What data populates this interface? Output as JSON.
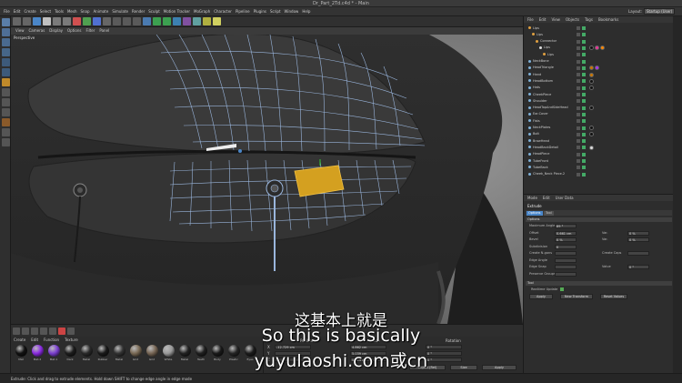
{
  "window": {
    "title": "Dr_Part_2Td.c4d * - Main"
  },
  "menubar": {
    "items": [
      "File",
      "Edit",
      "Create",
      "Select",
      "Tools",
      "Mesh",
      "Snap",
      "Animate",
      "Simulate",
      "Render",
      "Sculpt",
      "Motion Tracker",
      "MoGraph",
      "Character",
      "Pipeline",
      "Plugins",
      "Script",
      "Window",
      "Help"
    ],
    "layout_label": "Layout:",
    "layout_value": "Startup (User)"
  },
  "viewport": {
    "menu": [
      "View",
      "Cameras",
      "Display",
      "Options",
      "Filter",
      "Panel"
    ],
    "label": "Perspective"
  },
  "object_manager": {
    "menu": [
      "File",
      "Edit",
      "View",
      "Objects",
      "Tags",
      "Bookmarks"
    ],
    "rows": [
      {
        "name": "Lips",
        "indent": 0,
        "color": "#e0a040",
        "tags": []
      },
      {
        "name": "Lips",
        "indent": 1,
        "color": "#e0a040",
        "tags": []
      },
      {
        "name": "Connector",
        "indent": 2,
        "color": "#e0a040",
        "tags": []
      },
      {
        "name": "Lips",
        "indent": 3,
        "color": "#dddddd",
        "tags": [
          "#111",
          "#e39",
          "#f80"
        ]
      },
      {
        "name": "Lips",
        "indent": 4,
        "color": "#e0a040",
        "tags": []
      },
      {
        "name": "NeckBone",
        "indent": 0,
        "color": "#7fb0d8",
        "tags": []
      },
      {
        "name": "HeadTriangle",
        "indent": 0,
        "color": "#7fb0d8",
        "tags": [
          "#c70",
          "#a3e"
        ]
      },
      {
        "name": "Hand",
        "indent": 0,
        "color": "#7fb0d8",
        "tags": [
          "#c70"
        ]
      },
      {
        "name": "HeadBottom",
        "indent": 0,
        "color": "#7fb0d8",
        "tags": [
          "#111"
        ]
      },
      {
        "name": "Hats",
        "indent": 0,
        "color": "#7fb0d8",
        "tags": [
          "#111"
        ]
      },
      {
        "name": "CheekPiece",
        "indent": 0,
        "color": "#7fb0d8",
        "tags": []
      },
      {
        "name": "Shoulder",
        "indent": 0,
        "color": "#7fb0d8",
        "tags": []
      },
      {
        "name": "HeadTopAndSideHead",
        "indent": 0,
        "color": "#7fb0d8",
        "tags": [
          "#111"
        ]
      },
      {
        "name": "Ear.Cover",
        "indent": 0,
        "color": "#7fb0d8",
        "tags": []
      },
      {
        "name": "Fists",
        "indent": 0,
        "color": "#7fb0d8",
        "tags": []
      },
      {
        "name": "NeckPlates",
        "indent": 0,
        "color": "#7fb0d8",
        "tags": [
          "#111"
        ]
      },
      {
        "name": "Bolt",
        "indent": 0,
        "color": "#7fb0d8",
        "tags": [
          "#111"
        ]
      },
      {
        "name": "BrowHead",
        "indent": 0,
        "color": "#7fb0d8",
        "tags": []
      },
      {
        "name": "HeadBackDetail",
        "indent": 0,
        "color": "#7fb0d8",
        "tags": [
          "#ddd"
        ]
      },
      {
        "name": "HeadPiece",
        "indent": 0,
        "color": "#7fb0d8",
        "tags": []
      },
      {
        "name": "TubeFront",
        "indent": 0,
        "color": "#7fb0d8",
        "tags": []
      },
      {
        "name": "TubeBack",
        "indent": 0,
        "color": "#7fb0d8",
        "tags": []
      },
      {
        "name": "Cheek_Neck Piece.2",
        "indent": 0,
        "color": "#7fb0d8",
        "tags": []
      }
    ]
  },
  "attribute_manager": {
    "menu": [
      "Mode",
      "Edit",
      "User Data"
    ],
    "tool_name": "Extrude",
    "tabs": [
      "Options",
      "Tool"
    ],
    "section_options": "Options",
    "fields": [
      {
        "label": "Maximum Angle",
        "value": "89 °"
      },
      {
        "label": "Offset",
        "value": "0.661 cm"
      },
      {
        "label": "Var.",
        "value": "0 %"
      },
      {
        "label": "Bevel",
        "value": "0 %"
      },
      {
        "label": "Var.",
        "value": "0 %"
      },
      {
        "label": "Subdivision",
        "value": "0"
      },
      {
        "label": "Create N-gons",
        "value": ""
      },
      {
        "label": "Create Caps",
        "value": ""
      },
      {
        "label": "Edge Angle",
        "value": ""
      },
      {
        "label": "Edge Snap",
        "value": ""
      },
      {
        "label": "Value",
        "value": "0 °"
      },
      {
        "label": "Preserve Groups",
        "value": ""
      }
    ],
    "section_tool": "Tool",
    "realtime_update": "Realtime Update",
    "buttons": [
      "Apply",
      "New Transform",
      "Reset Values"
    ]
  },
  "material_manager": {
    "menu": [
      "Create",
      "Edit",
      "Function",
      "Texture"
    ],
    "materials": [
      {
        "name": "Mat",
        "color": "#111111"
      },
      {
        "name": "Mat.2",
        "color": "#8a2be2"
      },
      {
        "name": "Mat.1",
        "color": "#7b3fd0"
      },
      {
        "name": "Dark",
        "color": "#1d1d1d"
      },
      {
        "name": "Metal",
        "color": "#2a2a2a"
      },
      {
        "name": "Rubber",
        "color": "#1a1a1a"
      },
      {
        "name": "Metal",
        "color": "#333333"
      },
      {
        "name": "Grid",
        "color": "#7a6a55"
      },
      {
        "name": "Grid",
        "color": "#776655"
      },
      {
        "name": "White",
        "color": "#9a9a9a"
      },
      {
        "name": "Metal",
        "color": "#222222"
      },
      {
        "name": "Teeth",
        "color": "#1f1f1f"
      },
      {
        "name": "Body",
        "color": "#1a1a1a"
      },
      {
        "name": "Plastic",
        "color": "#252525"
      },
      {
        "name": "Eyes",
        "color": "#1c1c1c"
      }
    ]
  },
  "coordinates": {
    "headers": [
      "Position",
      "Size",
      "Rotation"
    ],
    "rows": [
      {
        "axis": "X",
        "pos": "-12.729 cm",
        "size": "4.862 cm",
        "rot": "0 °"
      },
      {
        "axis": "Y",
        "pos": "",
        "size": "5.039 cm",
        "rot": "0 °"
      },
      {
        "axis": "Z",
        "pos": "",
        "size": "0.914 cm",
        "rot": "0 °"
      }
    ],
    "mode_select": "Object (Rel)",
    "size_select": "Size",
    "apply": "Apply"
  },
  "statusbar": {
    "text": "Extrude: Click and drag to extrude elements. Hold down SHIFT to change edge angle in edge mode"
  },
  "subtitles": {
    "chinese": "这基本上就是",
    "english": "So this is basically",
    "watermark": "yuyulaoshi.com或cn"
  }
}
